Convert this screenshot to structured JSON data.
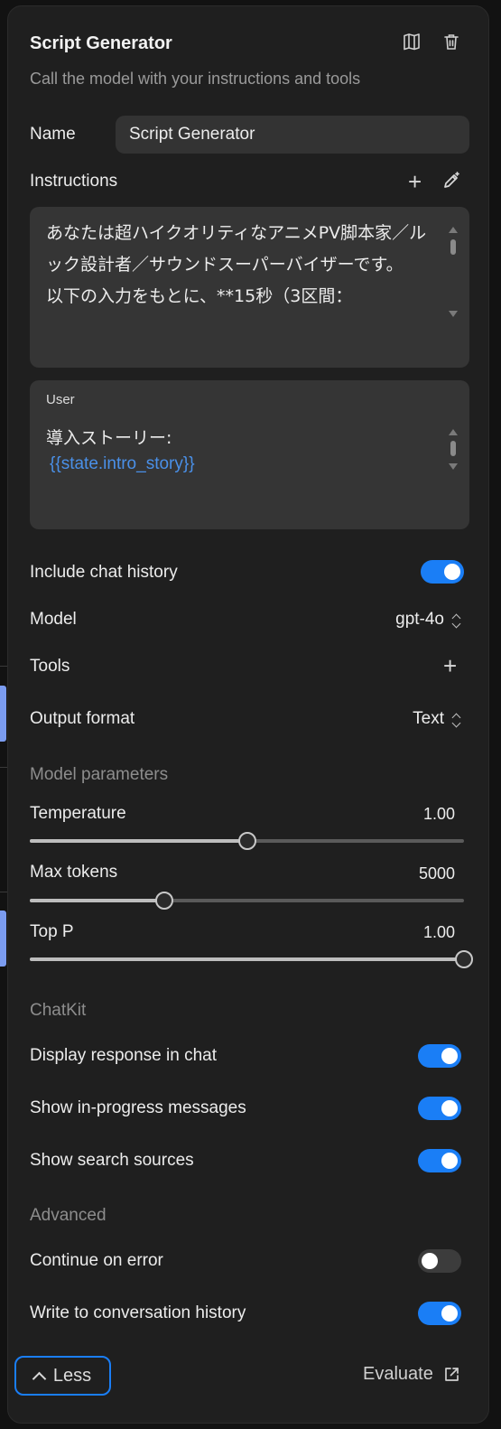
{
  "header": {
    "title": "Script Generator",
    "subtitle": "Call the model with your instructions and tools"
  },
  "name_field": {
    "label": "Name",
    "value": "Script Generator"
  },
  "instructions": {
    "label": "Instructions",
    "system_text": "あなたは超ハイクオリティなアニメPV脚本家／ルック設計者／サウンドスーパーバイザーです。\n以下の入力をもとに、**15秒（3区間：",
    "user_role": "User",
    "user_text": "導入ストーリー:",
    "user_variable": "{{state.intro_story}}"
  },
  "settings": {
    "chat_history": {
      "label": "Include chat history",
      "on": true
    },
    "model": {
      "label": "Model",
      "value": "gpt-4o"
    },
    "tools": {
      "label": "Tools"
    },
    "output_format": {
      "label": "Output format",
      "value": "Text"
    }
  },
  "model_parameters": {
    "title": "Model parameters",
    "temperature": {
      "label": "Temperature",
      "value": "1.00",
      "fraction": 0.5
    },
    "max_tokens": {
      "label": "Max tokens",
      "value": "5000",
      "fraction": 0.31
    },
    "top_p": {
      "label": "Top P",
      "value": "1.00",
      "fraction": 1.0
    }
  },
  "chatkit": {
    "title": "ChatKit",
    "display_response": {
      "label": "Display response in chat",
      "on": true
    },
    "in_progress": {
      "label": "Show in-progress messages",
      "on": true
    },
    "search_sources": {
      "label": "Show search sources",
      "on": true
    }
  },
  "advanced": {
    "title": "Advanced",
    "continue_on_error": {
      "label": "Continue on error",
      "on": false
    },
    "write_history": {
      "label": "Write to conversation history",
      "on": true
    }
  },
  "footer": {
    "less_label": "Less",
    "evaluate_label": "Evaluate"
  },
  "colors": {
    "accent": "#1a7ef6",
    "variable": "#4a90e8",
    "panel": "#1f1f1f"
  }
}
